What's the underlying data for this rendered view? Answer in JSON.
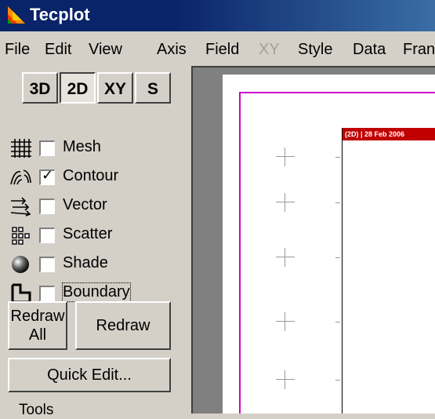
{
  "window": {
    "title": "Tecplot",
    "icon": "tecplot-logo-icon"
  },
  "menu": [
    "File",
    "Edit",
    "View",
    "Axis",
    "Field",
    "XY",
    "Style",
    "Data",
    "Fran"
  ],
  "menu_disabled": [
    "XY"
  ],
  "mode_buttons": [
    {
      "label": "3D",
      "pressed": false
    },
    {
      "label": "2D",
      "pressed": true
    },
    {
      "label": "XY",
      "pressed": false
    },
    {
      "label": "S",
      "pressed": false
    }
  ],
  "zone_layers": [
    {
      "label": "Mesh",
      "checked": false,
      "icon": "mesh-icon"
    },
    {
      "label": "Contour",
      "checked": true,
      "icon": "contour-icon"
    },
    {
      "label": "Vector",
      "checked": false,
      "icon": "vector-icon"
    },
    {
      "label": "Scatter",
      "checked": false,
      "icon": "scatter-icon"
    },
    {
      "label": "Shade",
      "checked": false,
      "icon": "shade-icon"
    },
    {
      "label": "Boundary",
      "checked": false,
      "icon": "boundary-icon"
    }
  ],
  "buttons": {
    "redraw_all": "Redraw All",
    "redraw": "Redraw",
    "quick_edit": "Quick Edit..."
  },
  "tools_label": "Tools",
  "frame_header": "(2D) | 28 Feb 2006",
  "colors": {
    "titlebar": "#0a246a",
    "frame_border": "#cc00cc",
    "frame_header": "#c00000",
    "workspace": "#808080"
  }
}
